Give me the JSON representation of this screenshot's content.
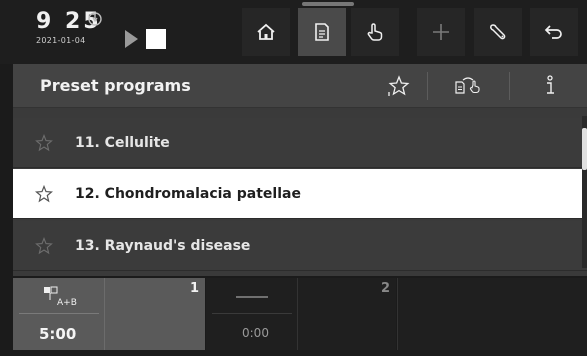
{
  "status": {
    "time": "9 25",
    "date": "2021-01-04"
  },
  "nav": {
    "items": [
      {
        "name": "home",
        "icon": "home-icon"
      },
      {
        "name": "programs",
        "icon": "document-icon",
        "active": true
      },
      {
        "name": "manual",
        "icon": "hand-pointer-icon"
      },
      {
        "name": "add",
        "icon": "plus-icon"
      },
      {
        "name": "settings",
        "icon": "wrench-icon"
      },
      {
        "name": "back",
        "icon": "return-arrow-icon"
      }
    ]
  },
  "panel": {
    "title": "Preset programs",
    "header_buttons": [
      "favorite-star-icon",
      "load-program-icon",
      "info-icon"
    ],
    "items": [
      {
        "label": "11. Cellulite",
        "selected": false
      },
      {
        "label": "12. Chondromalacia patellae",
        "selected": true
      },
      {
        "label": "13. Raynaud's disease",
        "selected": false
      }
    ]
  },
  "channels": [
    {
      "number": "1",
      "mode": "A+B",
      "duration": "5:00",
      "active": true
    },
    {
      "number": "2",
      "duration": "0:00",
      "active": false
    }
  ],
  "colors": {
    "selected_row": "#ffffff",
    "panel": "#3a3a3a",
    "header": "#444444"
  }
}
